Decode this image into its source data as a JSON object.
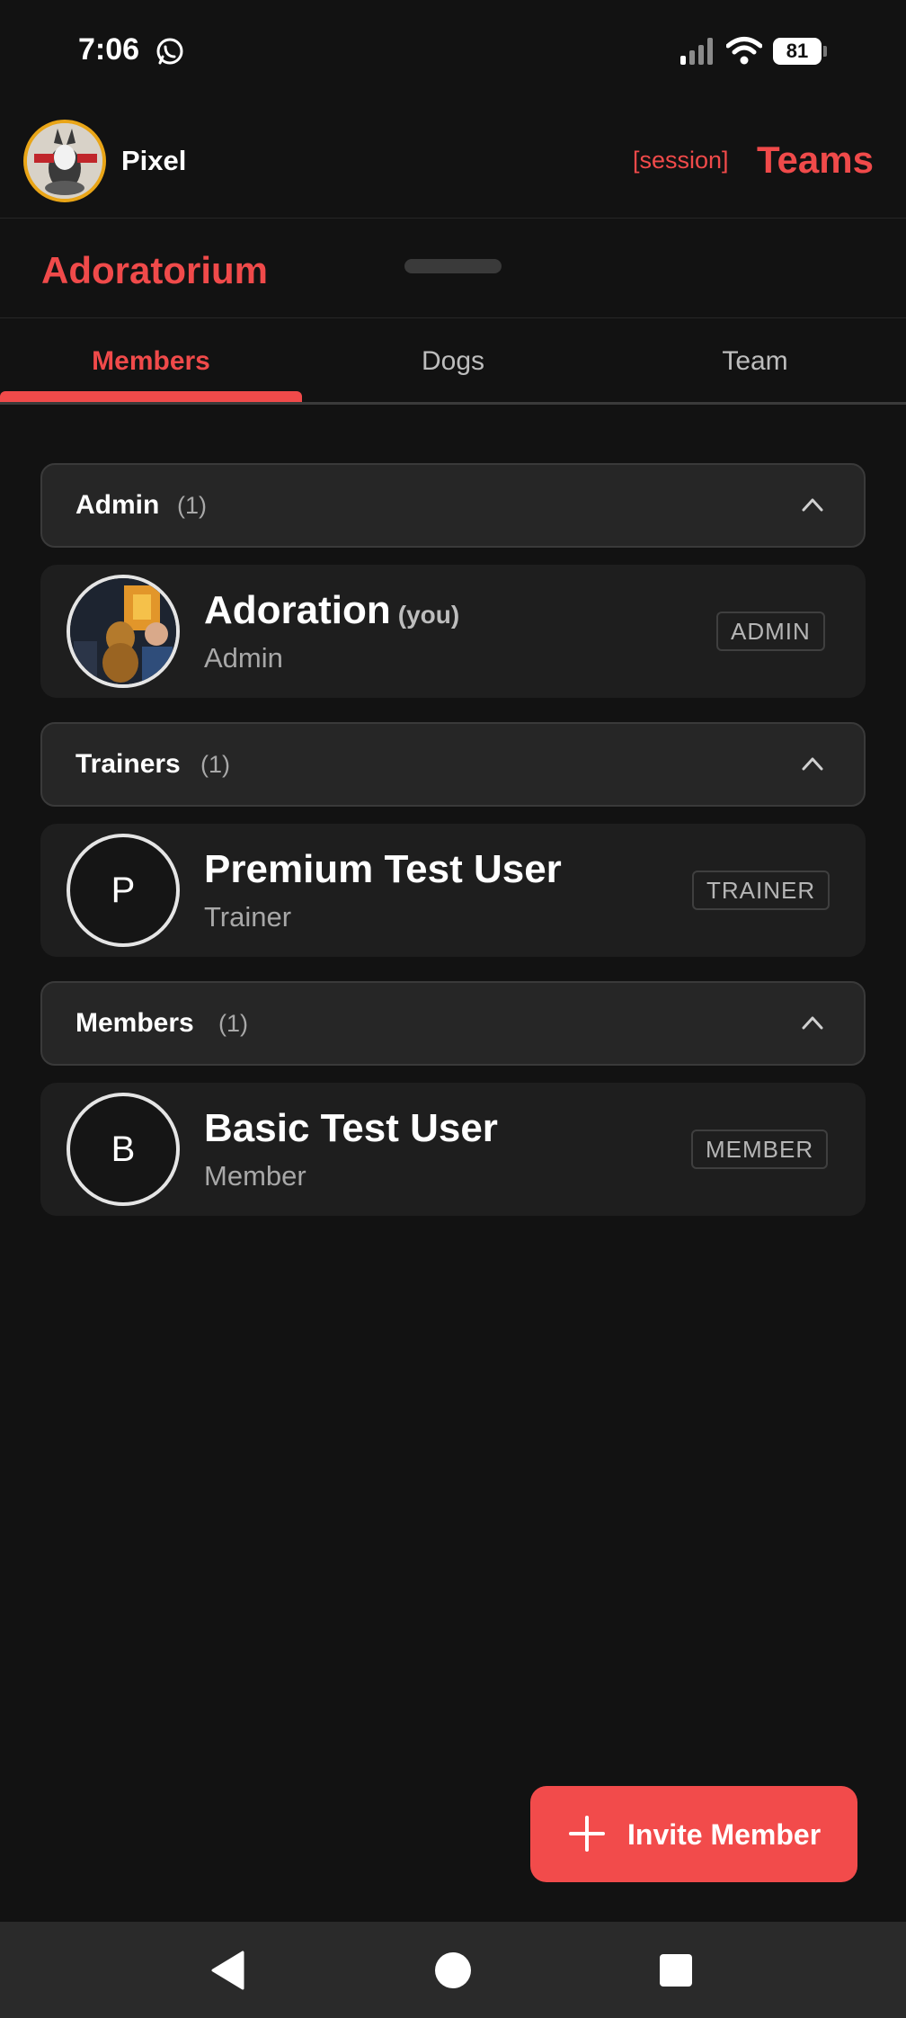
{
  "status_bar": {
    "time": "7:06",
    "battery": "81",
    "icons": [
      "whatsapp-icon",
      "signal-icon",
      "wifi-icon",
      "battery-icon"
    ]
  },
  "header": {
    "user_name": "Pixel",
    "session_label": "[session]",
    "title": "Teams"
  },
  "team": {
    "name": "Adoratorium"
  },
  "tabs": [
    {
      "label": "Members",
      "active": true
    },
    {
      "label": "Dogs",
      "active": false
    },
    {
      "label": "Team",
      "active": false
    }
  ],
  "sections": [
    {
      "title": "Admin",
      "count": "(1)",
      "members": [
        {
          "name": "Adoration",
          "you_label": "(you)",
          "role": "Admin",
          "badge": "ADMIN",
          "avatar_initial": ""
        }
      ]
    },
    {
      "title": "Trainers",
      "count": "(1)",
      "members": [
        {
          "name": "Premium Test User",
          "role": "Trainer",
          "badge": "TRAINER",
          "avatar_initial": "P"
        }
      ]
    },
    {
      "title": "Members",
      "count": "(1)",
      "members": [
        {
          "name": "Basic Test User",
          "role": "Member",
          "badge": "MEMBER",
          "avatar_initial": "B"
        }
      ]
    }
  ],
  "fab": {
    "label": "Invite Member",
    "icon": "plus-icon"
  },
  "colors": {
    "accent": "#f04a4a",
    "background": "#121212",
    "card": "#1e1e1e",
    "section_header": "#262626",
    "avatar_ring": "#e9a517"
  }
}
